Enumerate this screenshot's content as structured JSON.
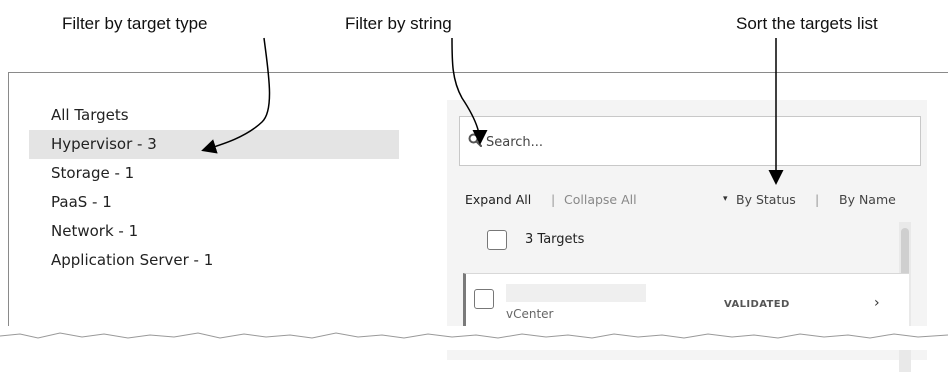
{
  "annotations": {
    "filter_type": "Filter by target type",
    "filter_string": "Filter by string",
    "sort_targets": "Sort the targets list"
  },
  "filters": [
    {
      "label": "All Targets",
      "selected": false
    },
    {
      "label": "Hypervisor - 3",
      "selected": true
    },
    {
      "label": "Storage - 1",
      "selected": false
    },
    {
      "label": "PaaS - 1",
      "selected": false
    },
    {
      "label": "Network - 1",
      "selected": false
    },
    {
      "label": "Application Server - 1",
      "selected": false
    }
  ],
  "search": {
    "placeholder": "Search...",
    "icon": "search-icon"
  },
  "controls": {
    "expand_all": "Expand All",
    "separator": "|",
    "collapse_all": "Collapse All",
    "sort_caret": "▾",
    "by_status": "By Status",
    "by_name": "By Name"
  },
  "targets_header": {
    "count_label": "3 Targets"
  },
  "rows": [
    {
      "name": "",
      "type": "vCenter",
      "status": "VALIDATED",
      "chevron": "›"
    }
  ],
  "colors": {
    "selected_bg": "#e4e4e4",
    "panel_bg": "#f4f4f4",
    "row_accent": "#7a7a7a"
  }
}
